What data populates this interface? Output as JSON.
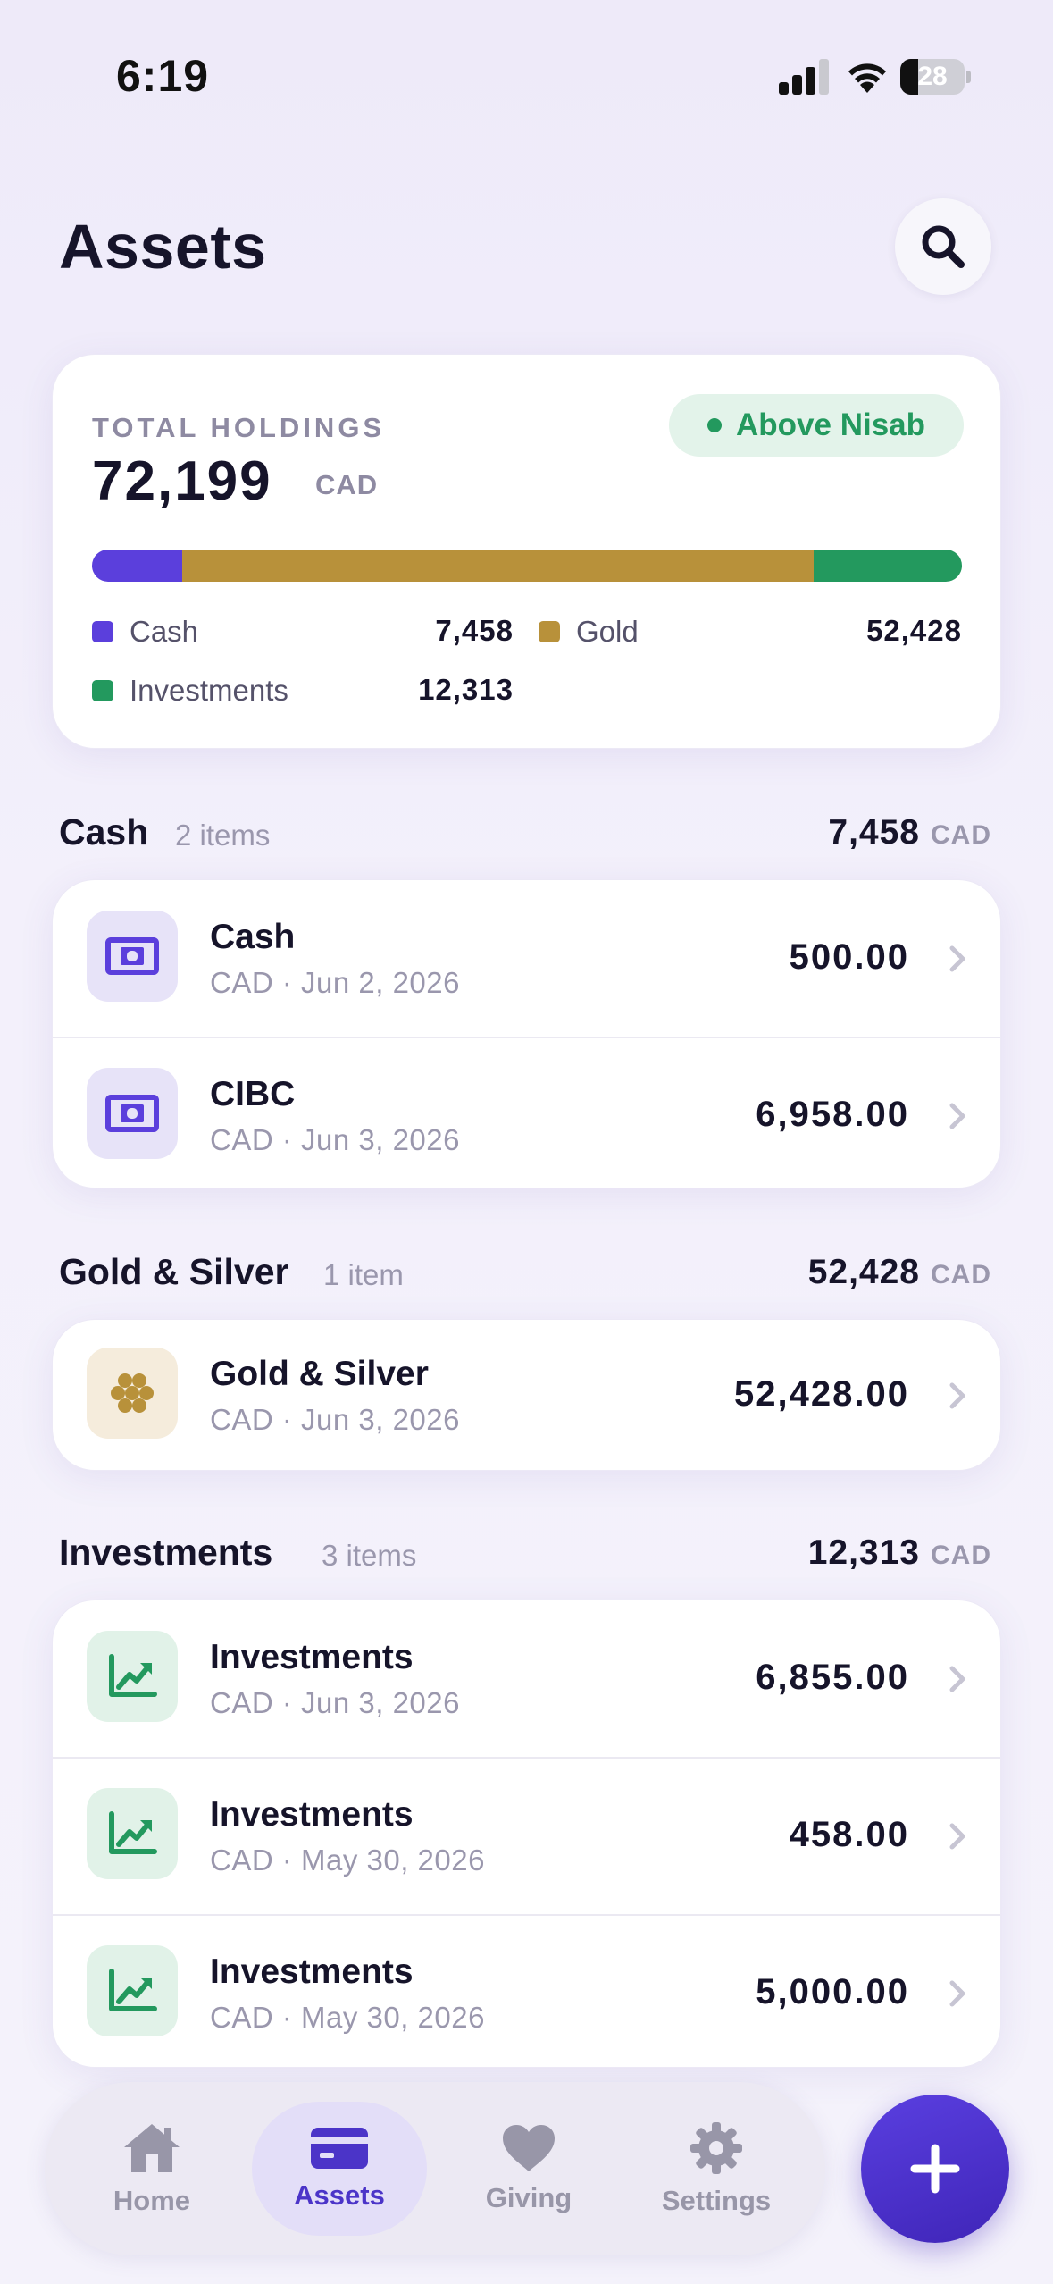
{
  "status_bar": {
    "time": "6:19",
    "battery": "28",
    "battery_level": 0.28
  },
  "header": {
    "title": "Assets"
  },
  "summary": {
    "label": "TOTAL HOLDINGS",
    "total": "72,199",
    "unit": "CAD",
    "badge": "Above Nisab",
    "breakdown": [
      {
        "name": "Cash",
        "value": "7,458",
        "amount": 7458,
        "color": "#5b3fdc"
      },
      {
        "name": "Gold",
        "value": "52,428",
        "amount": 52428,
        "color": "#b8913a"
      },
      {
        "name": "Investments",
        "value": "12,313",
        "amount": 12313,
        "color": "#23995e"
      }
    ]
  },
  "sections": [
    {
      "title": "Cash",
      "count": "2 items",
      "total": "7,458",
      "unit": "CAD",
      "items": [
        {
          "title": "Cash",
          "subtitle": "CAD · Jun 2, 2026",
          "amount": "500.00",
          "icon": "banknote-icon"
        },
        {
          "title": "CIBC",
          "subtitle": "CAD · Jun 3, 2026",
          "amount": "6,958.00",
          "icon": "banknote-icon"
        }
      ]
    },
    {
      "title": "Gold & Silver",
      "count": "1 item",
      "total": "52,428",
      "unit": "CAD",
      "items": [
        {
          "title": "Gold & Silver",
          "subtitle": "CAD · Jun 3, 2026",
          "amount": "52,428.00",
          "icon": "coins-icon"
        }
      ]
    },
    {
      "title": "Investments",
      "count": "3 items",
      "total": "12,313",
      "unit": "CAD",
      "items": [
        {
          "title": "Investments",
          "subtitle": "CAD · Jun 3, 2026",
          "amount": "6,855.00",
          "icon": "chart-up-icon"
        },
        {
          "title": "Investments",
          "subtitle": "CAD · May 30, 2026",
          "amount": "458.00",
          "icon": "chart-up-icon"
        },
        {
          "title": "Investments",
          "subtitle": "CAD · May 30, 2026",
          "amount": "5,000.00",
          "icon": "chart-up-icon"
        }
      ]
    }
  ],
  "tabbar": {
    "tabs": [
      {
        "label": "Home",
        "icon": "home-icon",
        "active": false
      },
      {
        "label": "Assets",
        "icon": "card-icon",
        "active": true
      },
      {
        "label": "Giving",
        "icon": "heart-icon",
        "active": false
      },
      {
        "label": "Settings",
        "icon": "gear-icon",
        "active": false
      }
    ],
    "fab_icon": "plus-icon"
  },
  "colors": {
    "accent": "#4b34c8",
    "cash": "#5b3fdc",
    "gold": "#b8913a",
    "investments": "#23995e",
    "badge_bg": "#e3f3ea"
  }
}
